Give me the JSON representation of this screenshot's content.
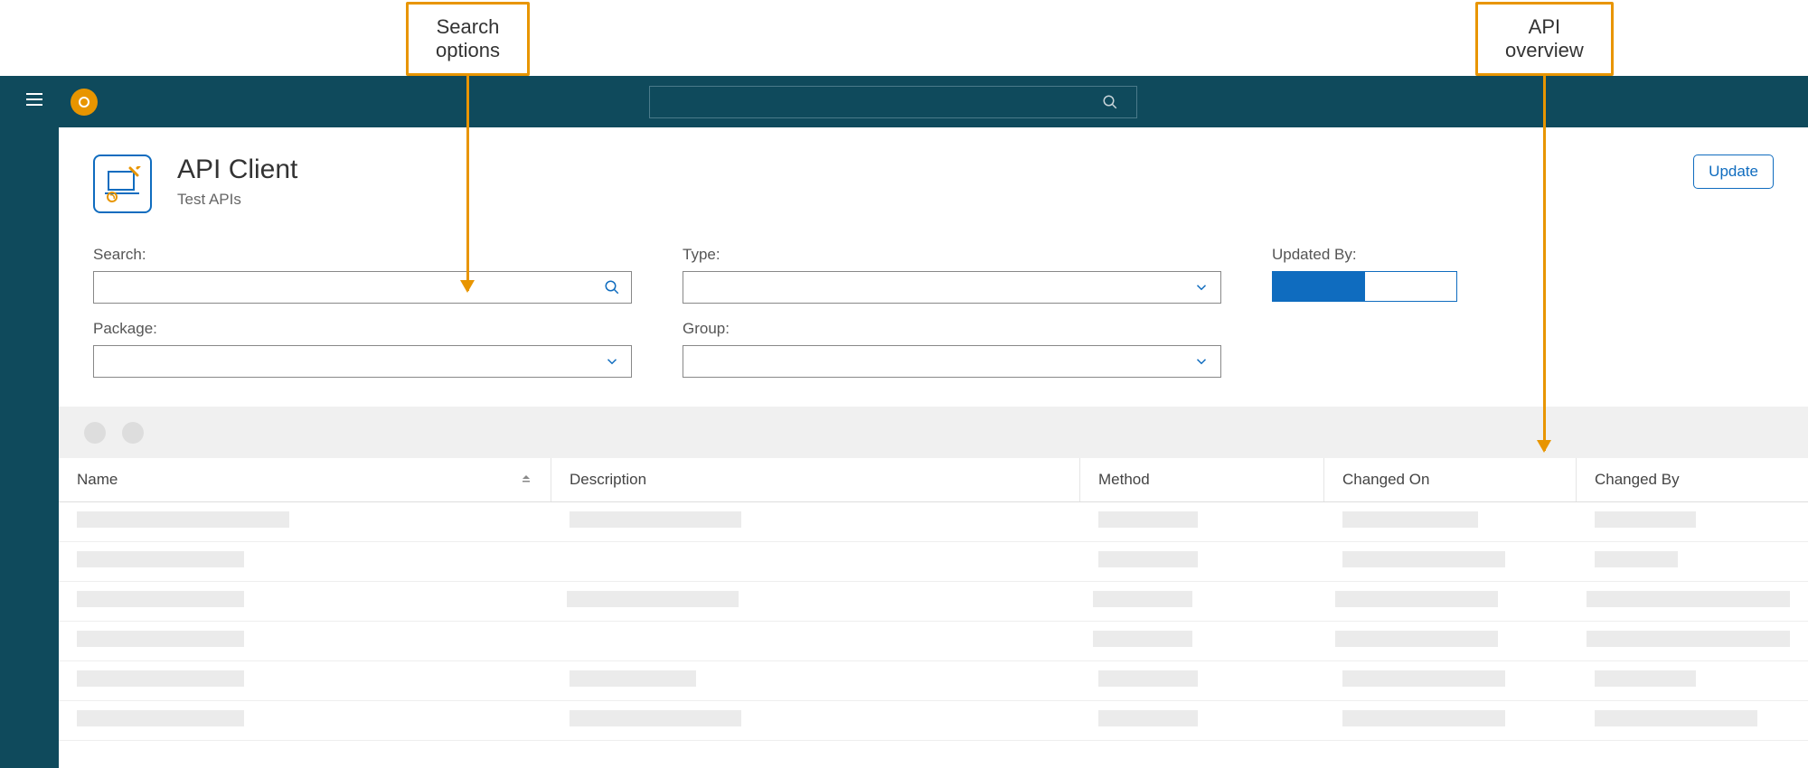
{
  "callouts": {
    "search_options": "Search\noptions",
    "api_overview": "API\noverview"
  },
  "header": {
    "title": "API Client",
    "subtitle": "Test APIs",
    "update_button": "Update"
  },
  "filters": {
    "search_label": "Search:",
    "type_label": "Type:",
    "updated_by_label": "Updated By:",
    "package_label": "Package:",
    "group_label": "Group:"
  },
  "table": {
    "columns": {
      "name": "Name",
      "description": "Description",
      "method": "Method",
      "changed_on": "Changed On",
      "changed_by": "Changed By"
    },
    "rows": [
      {
        "name_w": 235,
        "desc_w": 190,
        "method_w": 110,
        "chon_w": 150,
        "chby_w": 112
      },
      {
        "name_w": 185,
        "desc_w": 0,
        "method_w": 110,
        "chon_w": 180,
        "chby_w": 92
      },
      {
        "name_w": 185,
        "desc_w": 190,
        "method_w": 110,
        "chon_w": 180,
        "chby_w": 225
      },
      {
        "name_w": 185,
        "desc_w": 0,
        "method_w": 110,
        "chon_w": 180,
        "chby_w": 225
      },
      {
        "name_w": 185,
        "desc_w": 140,
        "method_w": 110,
        "chon_w": 180,
        "chby_w": 112
      },
      {
        "name_w": 185,
        "desc_w": 190,
        "method_w": 110,
        "chon_w": 180,
        "chby_w": 180
      }
    ]
  }
}
